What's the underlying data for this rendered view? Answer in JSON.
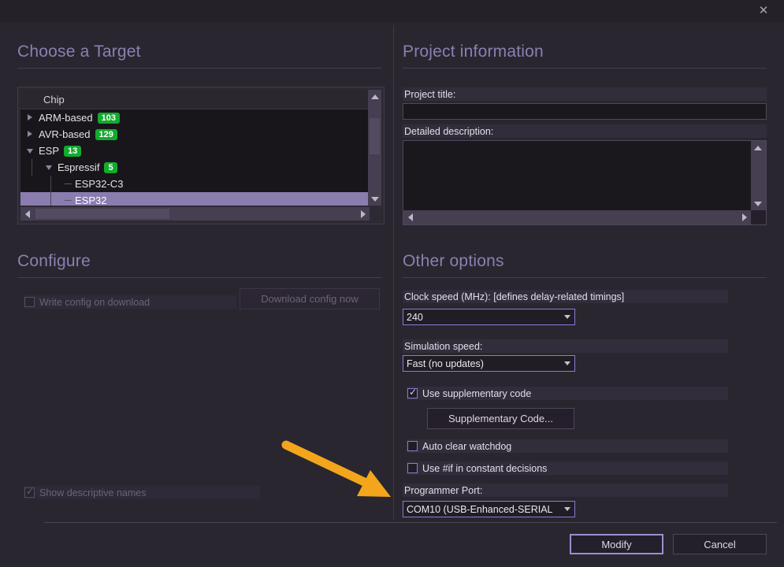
{
  "window": {
    "close_icon": "close-icon",
    "close_glyph": "✕"
  },
  "left": {
    "target_section": {
      "title": "Choose a Target",
      "tree": {
        "column_header": "Chip",
        "rows": [
          {
            "label": "ARM-based",
            "badge": "103",
            "depth": 0,
            "twist": "closed",
            "selected": false
          },
          {
            "label": "AVR-based",
            "badge": "129",
            "depth": 0,
            "twist": "closed",
            "selected": false
          },
          {
            "label": "ESP",
            "badge": "13",
            "depth": 0,
            "twist": "open",
            "selected": false
          },
          {
            "label": "Espressif",
            "badge": "5",
            "depth": 1,
            "twist": "open",
            "selected": false
          },
          {
            "label": "ESP32-C3",
            "badge": "",
            "depth": 2,
            "twist": "none",
            "selected": false
          },
          {
            "label": "ESP32",
            "badge": "",
            "depth": 2,
            "twist": "none",
            "selected": true
          }
        ]
      }
    },
    "configure_section": {
      "title": "Configure",
      "write_config_label": "Write config on download",
      "write_config_checked": false,
      "write_config_enabled": false,
      "download_config_label": "Download config now",
      "download_config_enabled": false,
      "show_descriptive_names_label": "Show descriptive names",
      "show_descriptive_names_checked": true,
      "show_descriptive_names_enabled": false
    }
  },
  "right": {
    "project_section": {
      "title": "Project information",
      "project_title_label": "Project title:",
      "project_title_value": "",
      "project_title_placeholder": "",
      "description_label": "Detailed description:",
      "description_value": "",
      "description_placeholder": ""
    },
    "other_section": {
      "title": "Other options",
      "clock_speed_label": "Clock speed (MHz): [defines delay-related timings]",
      "clock_speed_value": "240",
      "simulation_speed_label": "Simulation speed:",
      "simulation_speed_value": "Fast (no updates)",
      "use_supplementary_label": "Use supplementary code",
      "use_supplementary_checked": true,
      "supplementary_button_label": "Supplementary Code...",
      "auto_clear_watchdog_label": "Auto clear watchdog",
      "auto_clear_watchdog_checked": false,
      "use_if_label": "Use #if in constant decisions",
      "use_if_checked": false,
      "programmer_port_label": "Programmer Port:",
      "programmer_port_value": "COM10 (USB-Enhanced-SERIAL"
    }
  },
  "footer": {
    "modify_label": "Modify",
    "cancel_label": "Cancel"
  },
  "annotation": {
    "arrow_icon": "orange-arrow-annotation",
    "color": "#F3A51B"
  },
  "colors": {
    "accent_purple": "#8d7fb3",
    "selection": "#8b7cb0",
    "badge_green": "#12ab2e",
    "combo_border": "#8b7cd8",
    "annotation_orange": "#F3A51B"
  }
}
